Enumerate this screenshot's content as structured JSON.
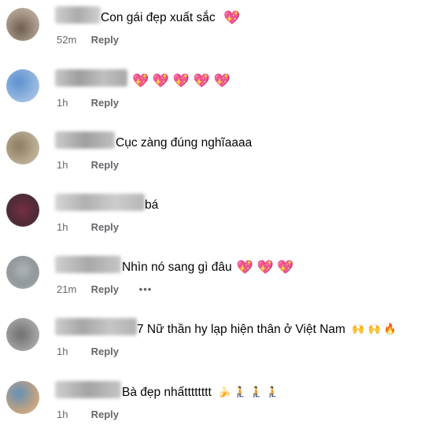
{
  "comments": [
    {
      "text": "Con gái đẹp xuất sắc ",
      "suffix": "💖",
      "time": "52m",
      "reply": "Reply"
    },
    {
      "text": "",
      "suffix": "💖 💖 💖 💖 💖",
      "time": "1h",
      "reply": "Reply"
    },
    {
      "text": "Cục zàng đúng nghĩaaaa",
      "suffix": "",
      "time": "1h",
      "reply": "Reply"
    },
    {
      "text": "bá",
      "suffix": "",
      "time": "1h",
      "reply": "Reply"
    },
    {
      "text": "Nhìn nó sang gì đâu",
      "suffix": "💖 💖 💖",
      "time": "21m",
      "reply": "Reply",
      "more": "•••"
    },
    {
      "text": "7 Nữ thần hy lạp hiện thân ở Việt Nam ",
      "suffix": "🙌 🙌 🔥",
      "time": "1h",
      "reply": "Reply"
    },
    {
      "text": "Bà đẹp nhấtttttttt ",
      "suffix": "🍌 🧎 🧎 🧎",
      "time": "1h",
      "reply": "Reply"
    }
  ]
}
